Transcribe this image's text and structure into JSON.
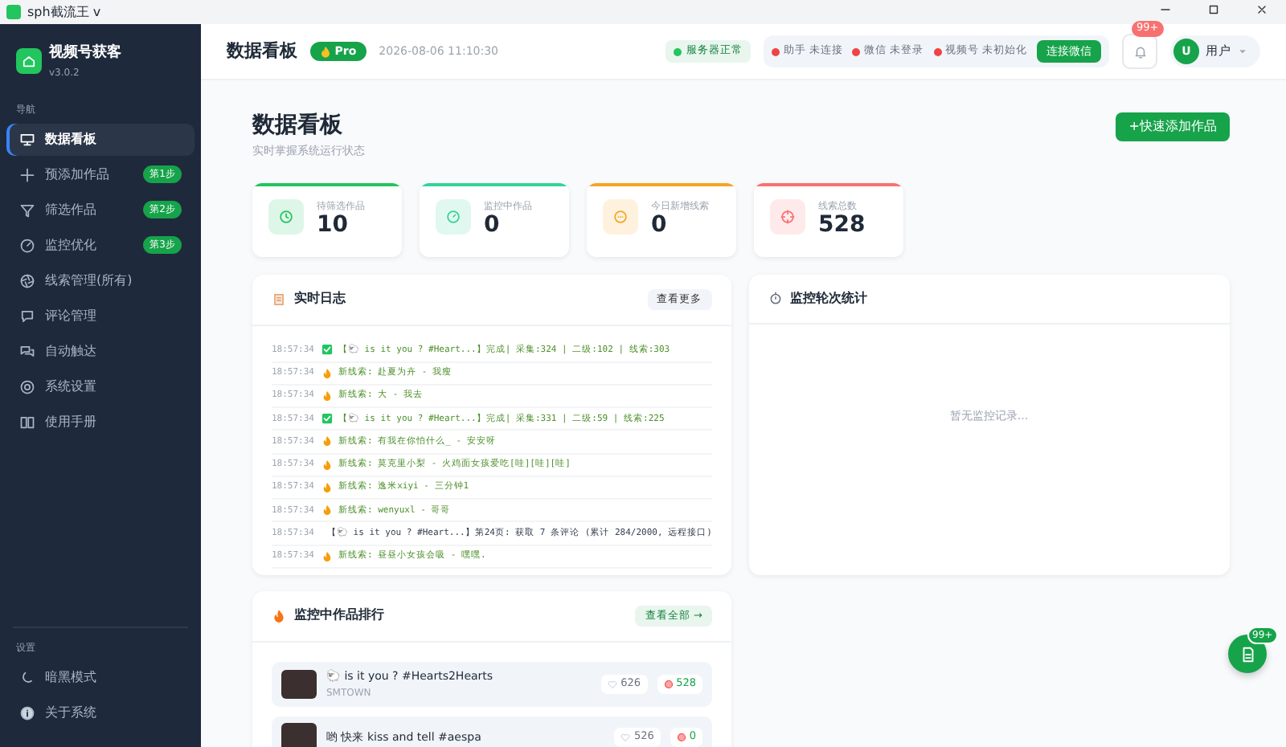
{
  "window": {
    "title": "sph截流王 v"
  },
  "sidebar": {
    "app_name": "视频号获客",
    "version": "v3.0.2",
    "section": "导航",
    "items": [
      {
        "label": "数据看板",
        "selected": true
      },
      {
        "label": "预添加作品",
        "selected": false,
        "badge": "第1步"
      },
      {
        "label": "筛选作品",
        "selected": false,
        "badge": "第2步"
      },
      {
        "label": "监控优化",
        "selected": false,
        "badge": "第3步"
      },
      {
        "label": "线索管理(所有)",
        "selected": false
      },
      {
        "label": "评论管理",
        "selected": false
      },
      {
        "label": "自动触达",
        "selected": false
      },
      {
        "label": "系统设置",
        "selected": false
      },
      {
        "label": "使用手册",
        "selected": false
      }
    ],
    "settings_section": "设置",
    "settings_items": [
      {
        "label": "暗黑模式"
      },
      {
        "label": "关于系统"
      }
    ]
  },
  "header": {
    "title": "数据看板",
    "badge": "Pro",
    "datetime": "2026-08-06 11:10:30",
    "server_status": {
      "label": "服务器正常",
      "color": "#22c55e"
    },
    "connections": [
      {
        "label": "助手",
        "status": "未连接",
        "color": "#ef4444"
      },
      {
        "label": "微信",
        "status": "未登录",
        "color": "#ef4444"
      },
      {
        "label": "视频号",
        "status": "未初始化",
        "color": "#ef4444"
      }
    ],
    "connect_button": "连接微信",
    "notification_count": "99+",
    "user": {
      "avatar": "U",
      "name": "用户"
    }
  },
  "page": {
    "title": "数据看板",
    "subtitle": "实时掌握系统运行状态",
    "action_button": "+快速添加作品"
  },
  "stats": [
    {
      "label": "待筛选作品",
      "value": "10",
      "color": "#22c55e"
    },
    {
      "label": "监控中作品",
      "value": "0",
      "color": "#34d399"
    },
    {
      "label": "今日新增线索",
      "value": "0",
      "color": "#f5a524"
    },
    {
      "label": "线索总数",
      "value": "528",
      "color": "#f87171"
    }
  ],
  "log_panel": {
    "title": "实时日志",
    "button": "查看更多",
    "entries": [
      {
        "time": "18:57:34",
        "kind": "done",
        "text": "【🐑 is it you ? #Heart...】完成| 采集:324 | 二级:102 | 线索:303"
      },
      {
        "time": "18:57:34",
        "kind": "clue",
        "text": "新线索: 赴夏为卉 - 我瘦"
      },
      {
        "time": "18:57:34",
        "kind": "clue",
        "text": "新线索: 大 - 我去"
      },
      {
        "time": "18:57:34",
        "kind": "done",
        "text": "【🐑 is it you ? #Heart...】完成| 采集:331 | 二级:59 | 线索:225"
      },
      {
        "time": "18:57:34",
        "kind": "clue",
        "text": "新线索: 有我在你怕什么_ - 安安呀"
      },
      {
        "time": "18:57:34",
        "kind": "clue",
        "text": "新线索: 莫克里小梨 - 火鸡面女孩爱吃[哇][哇][哇]"
      },
      {
        "time": "18:57:34",
        "kind": "clue",
        "text": "新线索: 逸米xiyi - 三分钟1"
      },
      {
        "time": "18:57:34",
        "kind": "clue",
        "text": "新线索: wenyuxl - 哥哥"
      },
      {
        "time": "18:57:34",
        "kind": "progress",
        "text": "【🐑 is it you ? #Heart...】第24页: 获取 7 条评论 (累计 284/2000, 远程接口)"
      },
      {
        "time": "18:57:34",
        "kind": "clue",
        "text": "新线索: 昼昼小女孩会吸 - 嘿嘿."
      }
    ]
  },
  "rounds_panel": {
    "title": "监控轮次统计",
    "empty_text": "暂无监控记录..."
  },
  "ranking_panel": {
    "title": "监控中作品排行",
    "button": "查看全部 →",
    "items": [
      {
        "title": "🐑 is it you ? #Hearts2Hearts",
        "author": "SMTOWN",
        "views": "626",
        "clues": "528"
      },
      {
        "title": "哟 快来 kiss and tell #aespa",
        "views": "526",
        "clues": "0"
      }
    ]
  },
  "fab": {
    "badge": "99+"
  }
}
